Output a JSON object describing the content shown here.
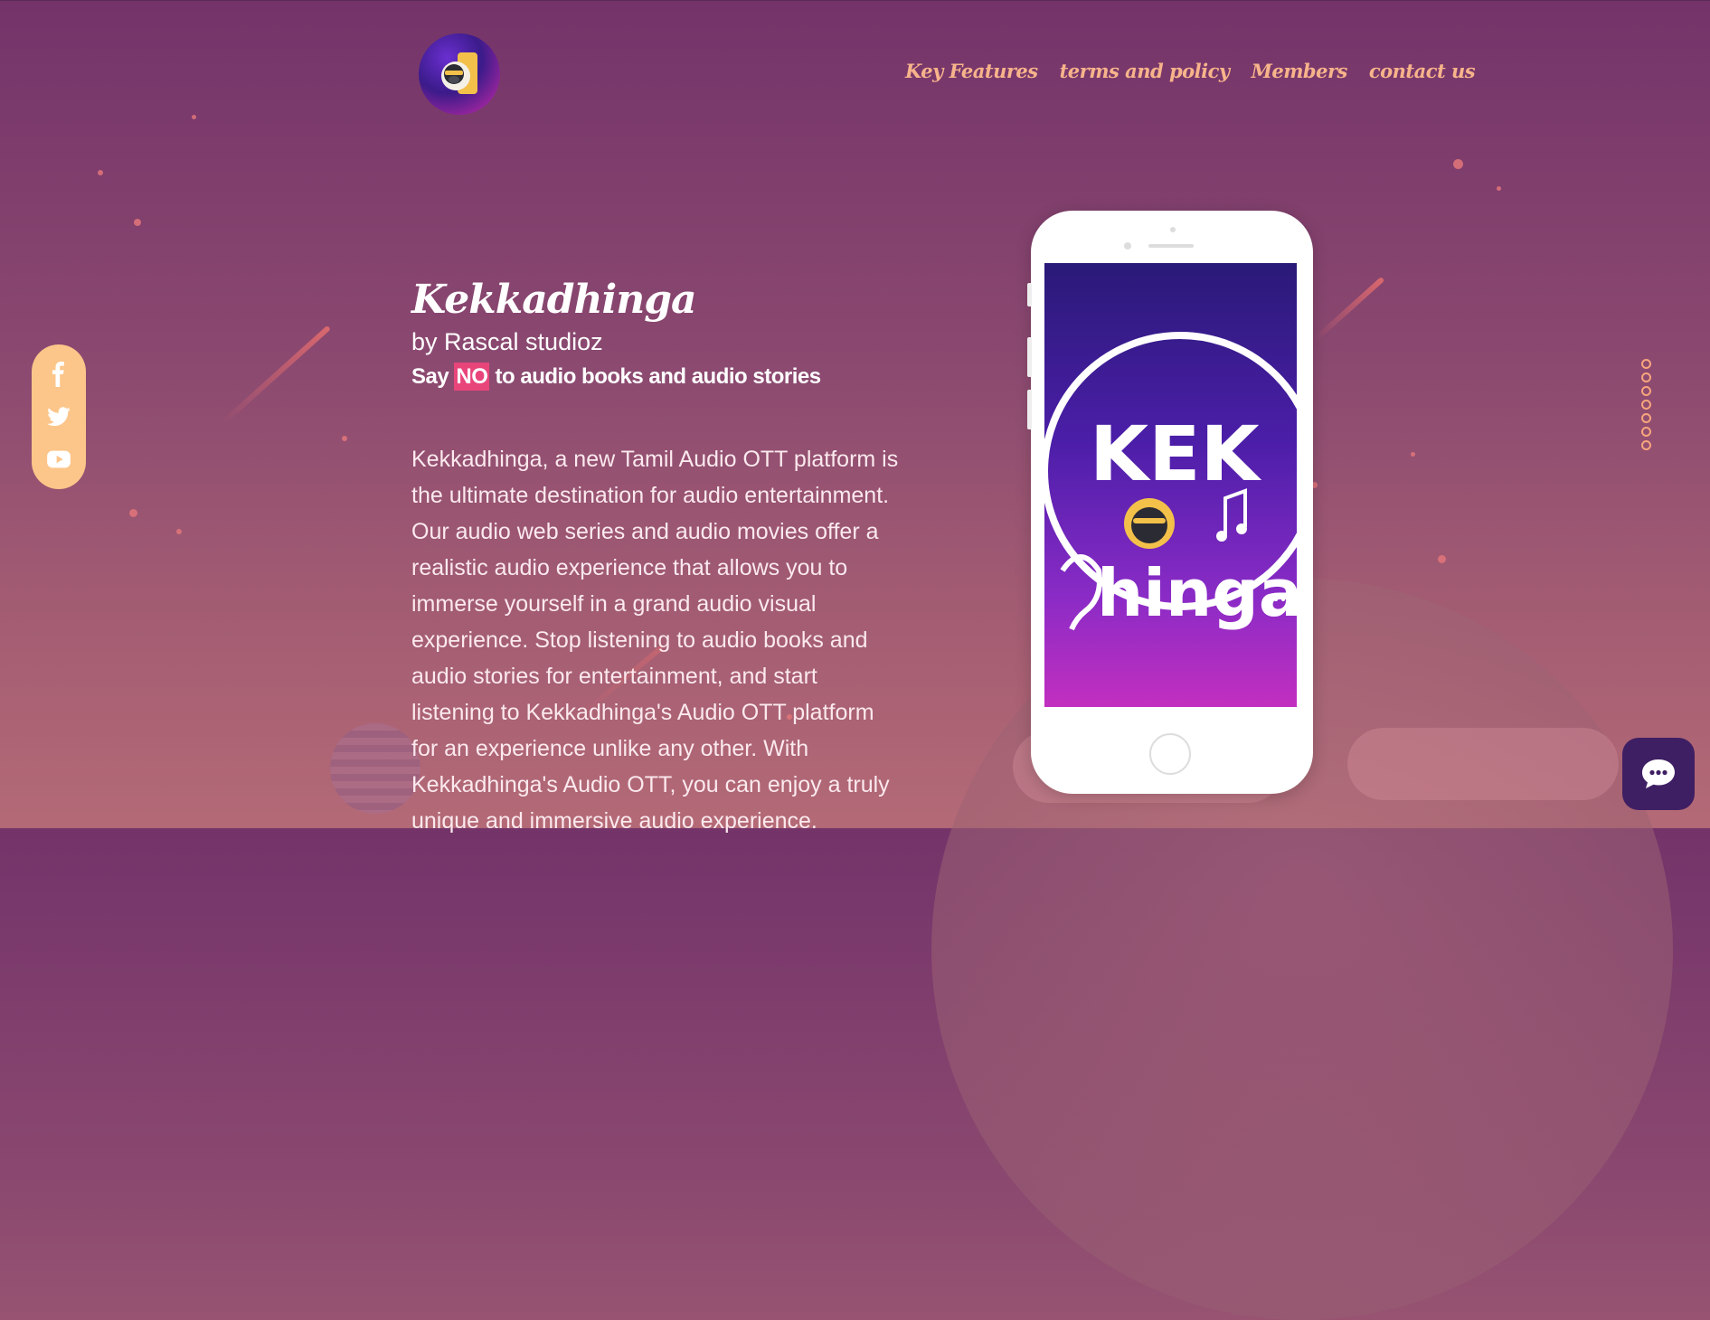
{
  "header": {
    "logo_alt": "Kekkadhinga logo",
    "nav": [
      {
        "label": "Key Features"
      },
      {
        "label": "terms and policy"
      },
      {
        "label": "Members"
      },
      {
        "label": "contact us"
      }
    ]
  },
  "social": [
    {
      "icon": "facebook-icon"
    },
    {
      "icon": "twitter-icon"
    },
    {
      "icon": "youtube-icon"
    }
  ],
  "hero": {
    "title": "Kekkadhinga",
    "byline": "by Rascal studioz",
    "tagline_pre": "Say ",
    "tagline_highlight": "NO",
    "tagline_post": " to audio books and audio stories",
    "description": "Kekkadhinga, a new Tamil Audio OTT platform is the ultimate destination for audio entertainment. Our audio web series and audio movies offer a realistic audio experience that allows you to immerse yourself in a grand audio visual experience. Stop listening to audio books and audio stories for entertainment, and start listening to Kekkadhinga's Audio OTT platform for an experience unlike any other. With Kekkadhinga's Audio OTT, you can enjoy a truly unique and immersive audio experience."
  },
  "phone_screen": {
    "art_text_top": "KEK",
    "art_text_bottom": "hinga"
  },
  "pager": {
    "count": 7
  },
  "chat": {
    "icon": "chat-icon"
  },
  "colors": {
    "nav": "#f7b48b",
    "social_bg": "#fcc68a",
    "highlight": "#e8457a",
    "chat_bg": "#3f1f63"
  }
}
